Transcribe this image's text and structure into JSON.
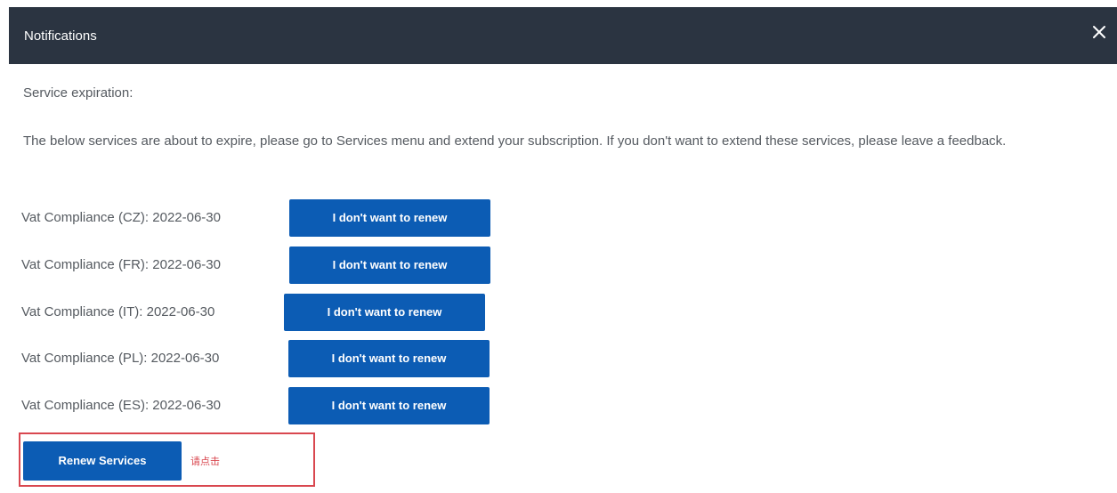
{
  "dialog": {
    "title": "Notifications",
    "close_icon": "close-icon",
    "section_title": "Service expiration:",
    "message": "The below services are about to expire, please go to Services menu and extend your subscription. If you don't want to extend these services, please leave a feedback."
  },
  "services": [
    {
      "label": "Vat Compliance (CZ): 2022-06-30",
      "button_label": "I don't want to renew"
    },
    {
      "label": "Vat Compliance (FR): 2022-06-30",
      "button_label": "I don't want to renew"
    },
    {
      "label": "Vat Compliance (IT): 2022-06-30",
      "button_label": "I don't want to renew"
    },
    {
      "label": "Vat Compliance (PL): 2022-06-30",
      "button_label": "I don't want to renew"
    },
    {
      "label": "Vat Compliance (ES): 2022-06-30",
      "button_label": "I don't want to renew"
    }
  ],
  "renew": {
    "button_label": "Renew Services",
    "annotation": "请点击"
  },
  "colors": {
    "header_bg": "#2b3441",
    "button_bg": "#0c5cb4",
    "annotation_red": "#d9474f",
    "text": "#555a60"
  }
}
